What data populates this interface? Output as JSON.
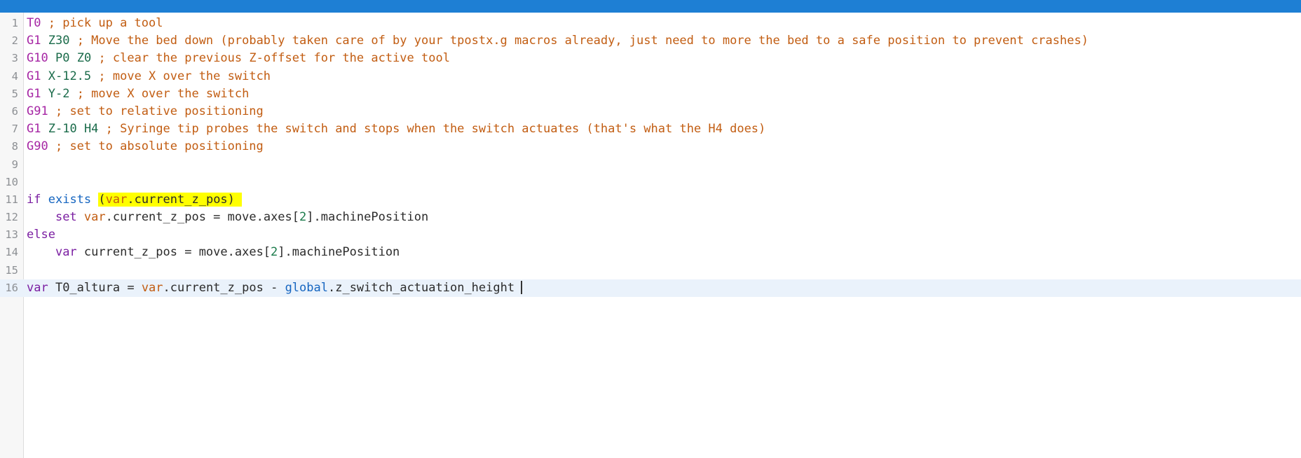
{
  "window": {
    "titlebar_color": "#1e7fd4"
  },
  "editor": {
    "gutter_color": "#f7f7f7",
    "active_line_color": "#eaf2fb",
    "highlight_color": "#ffff00",
    "lines": [
      {
        "number": "1",
        "tokens": [
          {
            "text": "T0",
            "kind": "gcode"
          },
          {
            "text": " ",
            "kind": "plain"
          },
          {
            "text": "; pick up a tool",
            "kind": "comment"
          }
        ]
      },
      {
        "number": "2",
        "tokens": [
          {
            "text": "G1",
            "kind": "gcode"
          },
          {
            "text": " ",
            "kind": "plain"
          },
          {
            "text": "Z30",
            "kind": "param"
          },
          {
            "text": " ",
            "kind": "plain"
          },
          {
            "text": "; Move the bed down (probably taken care of by your tpostx.g macros already, just need to more the bed to a safe position to prevent crashes)",
            "kind": "comment"
          }
        ]
      },
      {
        "number": "3",
        "tokens": [
          {
            "text": "G10",
            "kind": "gcode"
          },
          {
            "text": " ",
            "kind": "plain"
          },
          {
            "text": "P0",
            "kind": "param"
          },
          {
            "text": " ",
            "kind": "plain"
          },
          {
            "text": "Z0",
            "kind": "param"
          },
          {
            "text": " ",
            "kind": "plain"
          },
          {
            "text": "; clear the previous Z-offset for the active tool",
            "kind": "comment"
          }
        ]
      },
      {
        "number": "4",
        "tokens": [
          {
            "text": "G1",
            "kind": "gcode"
          },
          {
            "text": " ",
            "kind": "plain"
          },
          {
            "text": "X-12.5",
            "kind": "param"
          },
          {
            "text": " ",
            "kind": "plain"
          },
          {
            "text": "; move X over the switch",
            "kind": "comment"
          }
        ]
      },
      {
        "number": "5",
        "tokens": [
          {
            "text": "G1",
            "kind": "gcode"
          },
          {
            "text": " ",
            "kind": "plain"
          },
          {
            "text": "Y-2",
            "kind": "param"
          },
          {
            "text": " ",
            "kind": "plain"
          },
          {
            "text": "; move X over the switch",
            "kind": "comment"
          }
        ]
      },
      {
        "number": "6",
        "tokens": [
          {
            "text": "G91",
            "kind": "gcode"
          },
          {
            "text": " ",
            "kind": "plain"
          },
          {
            "text": "; set to relative positioning",
            "kind": "comment"
          }
        ]
      },
      {
        "number": "7",
        "tokens": [
          {
            "text": "G1",
            "kind": "gcode"
          },
          {
            "text": " ",
            "kind": "plain"
          },
          {
            "text": "Z-10",
            "kind": "param"
          },
          {
            "text": " ",
            "kind": "plain"
          },
          {
            "text": "H4",
            "kind": "param"
          },
          {
            "text": " ",
            "kind": "plain"
          },
          {
            "text": "; Syringe tip probes the switch and stops when the switch actuates (that's what the H4 does)",
            "kind": "comment"
          }
        ]
      },
      {
        "number": "8",
        "tokens": [
          {
            "text": "G90",
            "kind": "gcode"
          },
          {
            "text": " ",
            "kind": "plain"
          },
          {
            "text": "; set to absolute positioning",
            "kind": "comment"
          }
        ]
      },
      {
        "number": "9",
        "tokens": []
      },
      {
        "number": "10",
        "tokens": []
      },
      {
        "number": "11",
        "tokens": [
          {
            "text": "if",
            "kind": "kw"
          },
          {
            "text": " ",
            "kind": "plain"
          },
          {
            "text": "exists",
            "kind": "fn"
          },
          {
            "text": " ",
            "kind": "plain"
          },
          {
            "text": "(",
            "kind": "plain",
            "highlight": true
          },
          {
            "text": "var",
            "kind": "obj",
            "highlight": true
          },
          {
            "text": ".current_z_pos)",
            "kind": "plain",
            "highlight": true
          },
          {
            "text": " ",
            "kind": "plain",
            "highlight": true
          }
        ]
      },
      {
        "number": "12",
        "tokens": [
          {
            "text": "    ",
            "kind": "plain"
          },
          {
            "text": "set",
            "kind": "kw"
          },
          {
            "text": " ",
            "kind": "plain"
          },
          {
            "text": "var",
            "kind": "obj"
          },
          {
            "text": ".current_z_pos ",
            "kind": "plain"
          },
          {
            "text": "=",
            "kind": "op"
          },
          {
            "text": " move.axes[",
            "kind": "plain"
          },
          {
            "text": "2",
            "kind": "num"
          },
          {
            "text": "].machinePosition",
            "kind": "plain"
          }
        ]
      },
      {
        "number": "13",
        "tokens": [
          {
            "text": "else",
            "kind": "kw"
          }
        ]
      },
      {
        "number": "14",
        "tokens": [
          {
            "text": "    ",
            "kind": "plain"
          },
          {
            "text": "var",
            "kind": "kw"
          },
          {
            "text": " current_z_pos ",
            "kind": "plain"
          },
          {
            "text": "=",
            "kind": "op"
          },
          {
            "text": " move.axes[",
            "kind": "plain"
          },
          {
            "text": "2",
            "kind": "num"
          },
          {
            "text": "].machinePosition",
            "kind": "plain"
          }
        ]
      },
      {
        "number": "15",
        "tokens": []
      },
      {
        "number": "16",
        "active": true,
        "caret": true,
        "tokens": [
          {
            "text": "var",
            "kind": "kw"
          },
          {
            "text": " T0_altura ",
            "kind": "plain"
          },
          {
            "text": "=",
            "kind": "op"
          },
          {
            "text": " ",
            "kind": "plain"
          },
          {
            "text": "var",
            "kind": "obj"
          },
          {
            "text": ".current_z_pos ",
            "kind": "plain"
          },
          {
            "text": "-",
            "kind": "op"
          },
          {
            "text": " ",
            "kind": "plain"
          },
          {
            "text": "global",
            "kind": "fn"
          },
          {
            "text": ".z_switch_actuation_height",
            "kind": "plain"
          }
        ]
      }
    ]
  }
}
